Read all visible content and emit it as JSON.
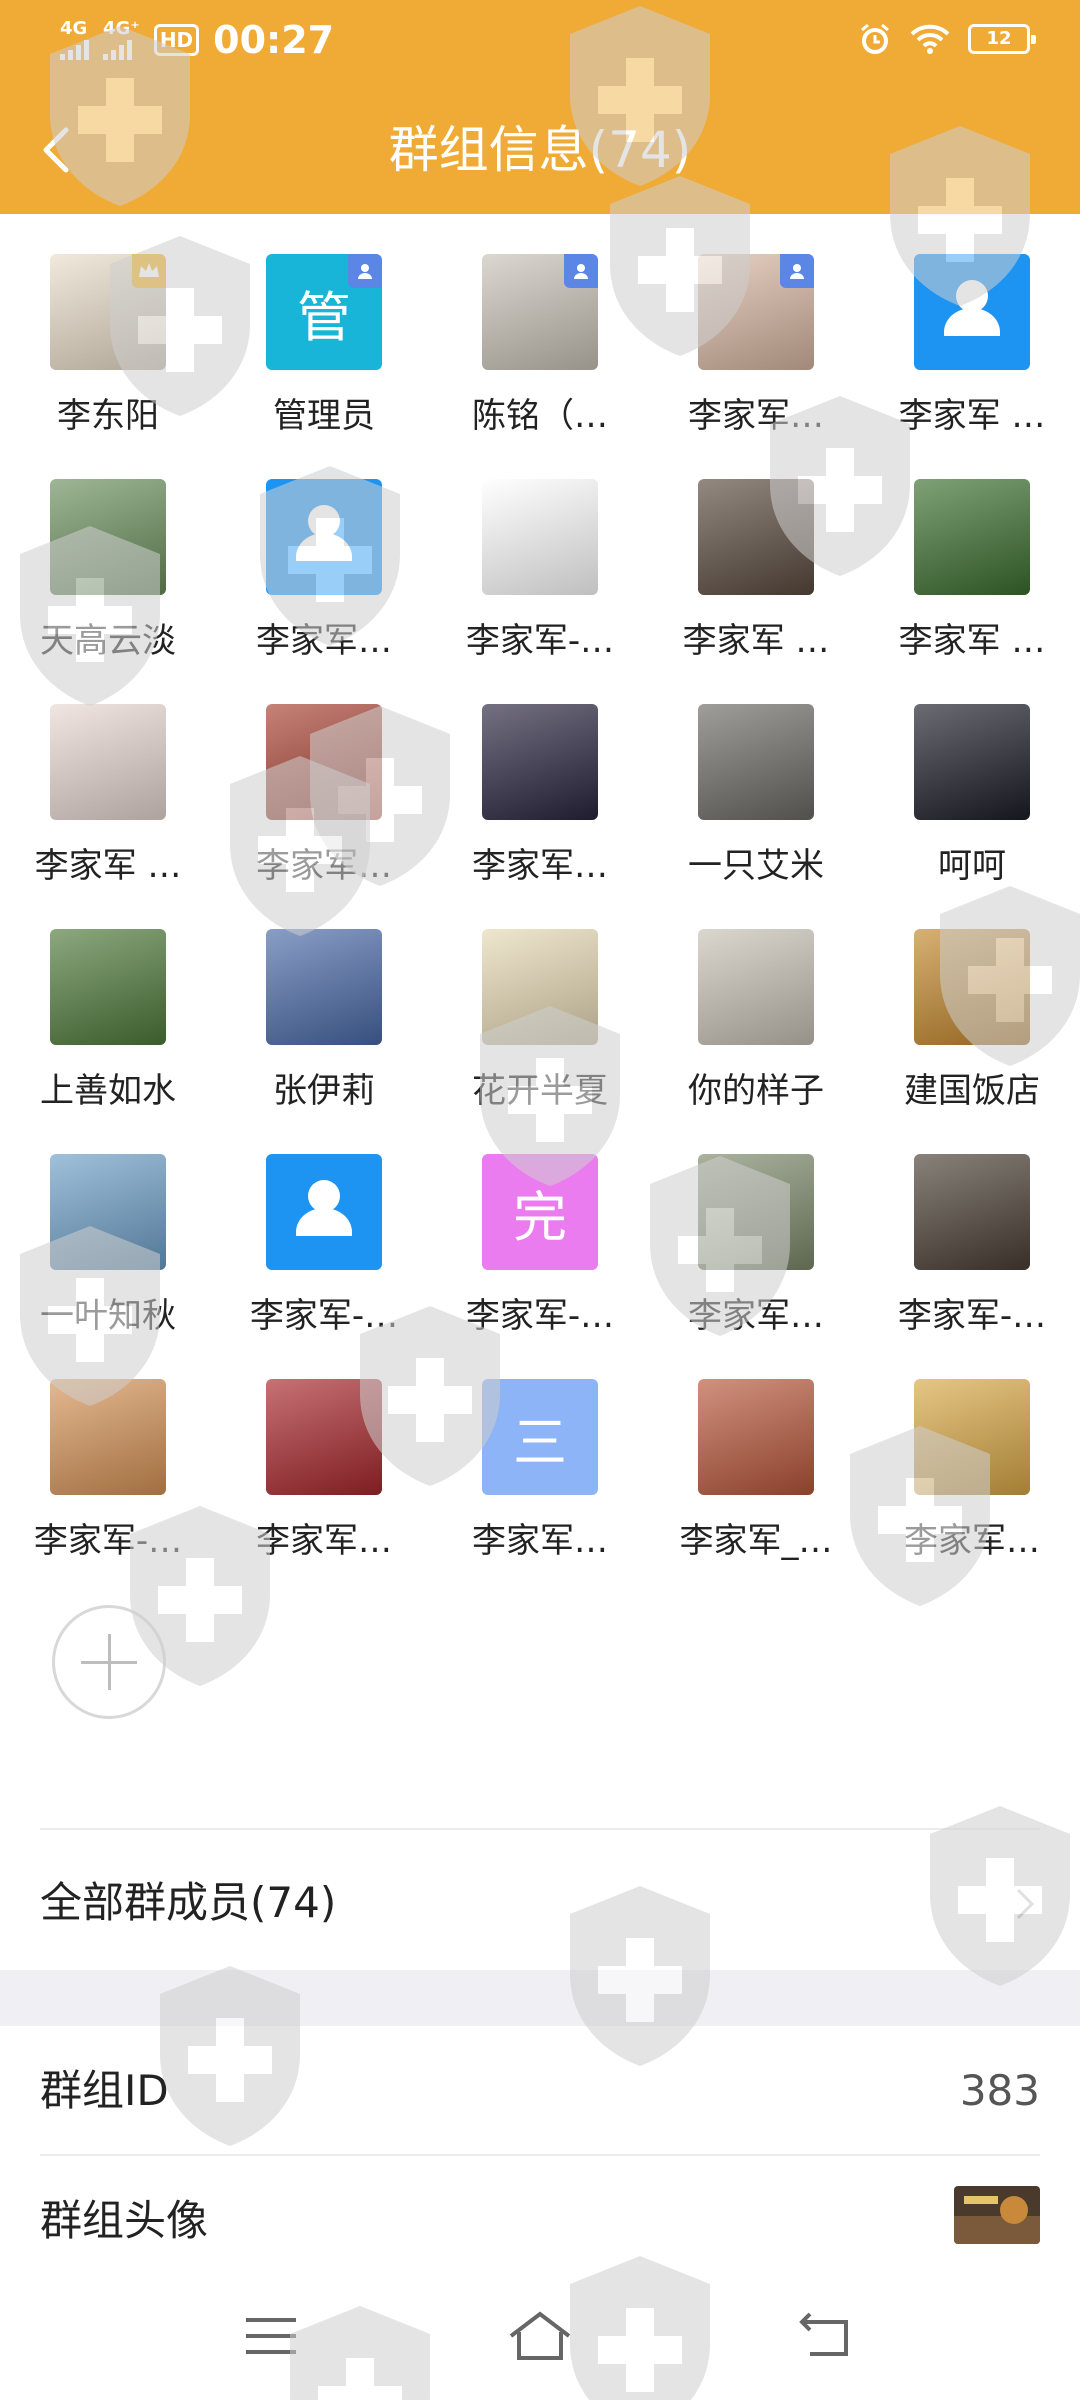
{
  "status_bar": {
    "network_1": "4G",
    "network_2": "4G⁺",
    "hd_label": "HD",
    "time": "00:27",
    "battery": "12"
  },
  "header": {
    "title": "群组信息(74)"
  },
  "members": [
    {
      "name": "李东阳",
      "badge": "crown-icon",
      "avatar_color": "#e9ddc9"
    },
    {
      "name": "管理员",
      "badge": "admin-icon",
      "avatar_color": "#18b5d8",
      "initial": "管"
    },
    {
      "name": "陈铭（…",
      "badge": "admin-icon",
      "avatar_color": "#c9c3b8"
    },
    {
      "name": "李家军…",
      "badge": "admin-icon",
      "avatar_color": "#d8b7a2"
    },
    {
      "name": "李家军 …",
      "avatar_color": "#1e94f2",
      "default_icon": true
    },
    {
      "name": "天高云淡",
      "avatar_color": "#6a8f5c"
    },
    {
      "name": "李家军…",
      "avatar_color": "#1e94f2",
      "default_icon": true
    },
    {
      "name": "李家军-…",
      "avatar_color": "#ffffff"
    },
    {
      "name": "李家军 …",
      "avatar_color": "#5a4a3e"
    },
    {
      "name": "李家军 …",
      "avatar_color": "#3b6e2e"
    },
    {
      "name": "李家军 …",
      "avatar_color": "#e8d8d2"
    },
    {
      "name": "李家军…",
      "avatar_color": "#a84030"
    },
    {
      "name": "李家军…",
      "avatar_color": "#2a2540"
    },
    {
      "name": "一只艾米",
      "avatar_color": "#6c6a66"
    },
    {
      "name": "呵呵",
      "avatar_color": "#1c1c28"
    },
    {
      "name": "上善如水",
      "avatar_color": "#4e7a3a"
    },
    {
      "name": "张伊莉",
      "avatar_color": "#4a6aa8"
    },
    {
      "name": "花开半夏",
      "avatar_color": "#e6d9b4"
    },
    {
      "name": "你的样子",
      "avatar_color": "#c8c2b6"
    },
    {
      "name": "建国饭店",
      "avatar_color": "#c2862a"
    },
    {
      "name": "一叶知秋",
      "avatar_color": "#6d9fc8"
    },
    {
      "name": "李家军-…",
      "avatar_color": "#1e94f2",
      "default_icon": true
    },
    {
      "name": "李家军-…",
      "avatar_color": "#ea7cf0",
      "initial": "完"
    },
    {
      "name": "李家军…",
      "avatar_color": "#7d8a6a"
    },
    {
      "name": "李家军-…",
      "avatar_color": "#4a3f34"
    },
    {
      "name": "李家军-…",
      "avatar_color": "#d69356"
    },
    {
      "name": "李家军…",
      "avatar_color": "#a8262c"
    },
    {
      "name": "李家军…",
      "avatar_color": "#8cb4f6",
      "initial": "三"
    },
    {
      "name": "李家军_…",
      "avatar_color": "#b8563a"
    },
    {
      "name": "李家军…",
      "avatar_color": "#d9a845"
    }
  ],
  "all_members": {
    "label": "全部群成员(74)"
  },
  "group_id": {
    "label": "群组ID",
    "value": "383"
  },
  "group_avatar": {
    "label": "群组头像"
  },
  "colors": {
    "header": "#efab36",
    "default_avatar": "#1e94f2",
    "admin_badge": "#5b86e5",
    "crown_badge": "#f0b429"
  }
}
